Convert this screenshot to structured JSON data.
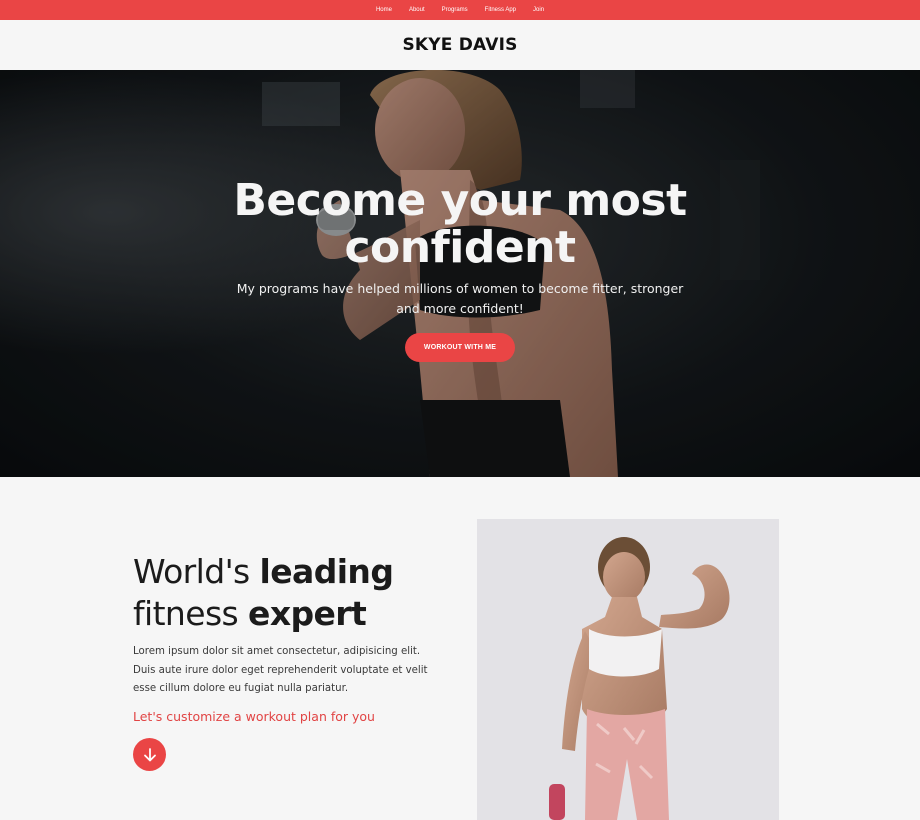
{
  "nav": {
    "items": [
      "Home",
      "About",
      "Programs",
      "Fitness App",
      "Join"
    ]
  },
  "brand": {
    "name": "SKYE DAVIS"
  },
  "hero": {
    "title_line1": "Become your most",
    "title_line2": "confident",
    "subtitle": "My programs have helped millions of women to become fitter, stronger and more confident!",
    "button_label": "WORKOUT WITH ME"
  },
  "about": {
    "heading_light1": "World's ",
    "heading_bold1": "leading",
    "heading_light2": "fitness ",
    "heading_bold2": "expert",
    "body": "Lorem ipsum dolor sit amet consectetur, adipisicing elit. Duis aute irure dolor eget reprehenderit voluptate et velit esse cillum dolore eu fugiat nulla pariatur.",
    "cta": "Let's customize a workout plan for you"
  },
  "colors": {
    "accent": "#ea4545",
    "hero_dark": "#14181b",
    "page_bg": "#f6f6f6"
  },
  "icons": {
    "down_button": "arrow-down-icon"
  }
}
